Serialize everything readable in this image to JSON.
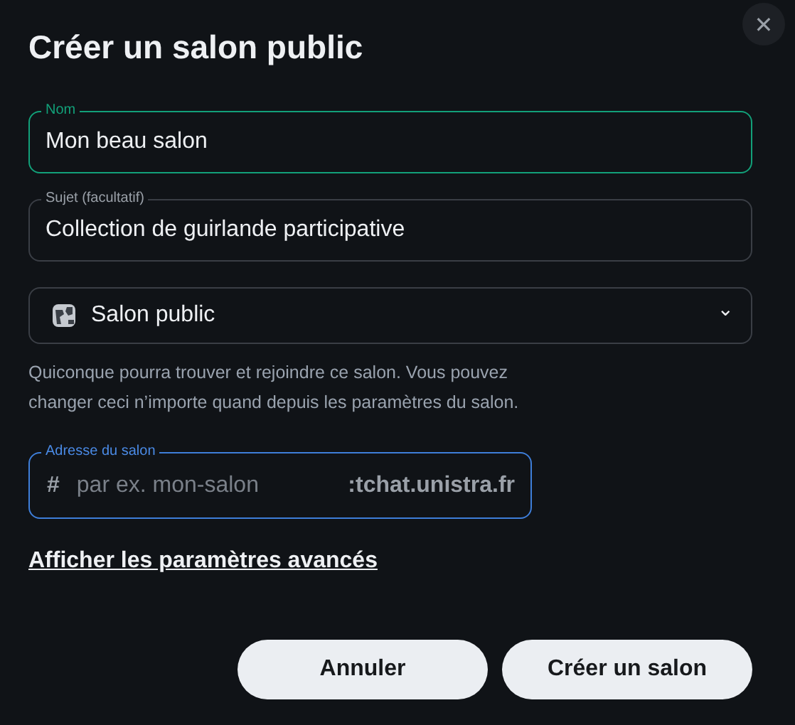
{
  "dialog": {
    "title": "Créer un salon public",
    "close": "✕"
  },
  "name_field": {
    "label": "Nom",
    "value": "Mon beau salon",
    "focused": true
  },
  "topic_field": {
    "label": "Sujet (facultatif)",
    "value": "Collection de guirlande participative",
    "focused": false
  },
  "visibility_select": {
    "value": "Salon public",
    "caret": "⌄"
  },
  "description": "Quiconque pourra trouver et rejoindre ce salon. Vous pouvez changer ceci n’importe quand depuis les paramètres du salon.",
  "address_field": {
    "label": "Adresse du salon",
    "prefix": "#",
    "placeholder": "par ex. mon-salon",
    "suffix": ":tchat.unistra.fr",
    "focused": true
  },
  "advanced_link": "Afficher les paramètres avancés",
  "buttons": [
    {
      "label": "Annuler"
    },
    {
      "label": "Créer un salon"
    }
  ]
}
